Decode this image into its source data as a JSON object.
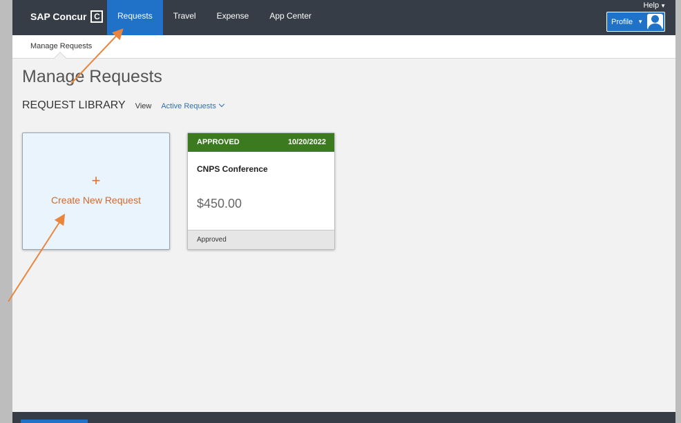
{
  "app": {
    "brand": "SAP Concur",
    "brand_mark": "C"
  },
  "topnav": {
    "tabs": [
      {
        "label": "Requests",
        "active": true
      },
      {
        "label": "Travel",
        "active": false
      },
      {
        "label": "Expense",
        "active": false
      },
      {
        "label": "App Center",
        "active": false
      }
    ],
    "help_label": "Help",
    "profile_label": "Profile"
  },
  "subnav": {
    "items": [
      "Manage Requests"
    ]
  },
  "page": {
    "title": "Manage Requests",
    "library_title": "REQUEST LIBRARY",
    "view_label": "View",
    "view_selected": "Active Requests"
  },
  "create_tile": {
    "plus": "+",
    "label": "Create New Request"
  },
  "requests": [
    {
      "status": "APPROVED",
      "date": "10/20/2022",
      "name": "CNPS Conference",
      "amount": "$450.00",
      "footer_status": "Approved"
    }
  ],
  "colors": {
    "nav_bg": "#363d46",
    "nav_active": "#1f72c8",
    "approved_header": "#3b7a1e",
    "create_accent": "#d4692c",
    "annotation_arrow": "#e9853d"
  },
  "icons": {
    "help_caret": "caret-down",
    "profile_caret": "caret-down",
    "view_chevron": "chevron-down"
  }
}
